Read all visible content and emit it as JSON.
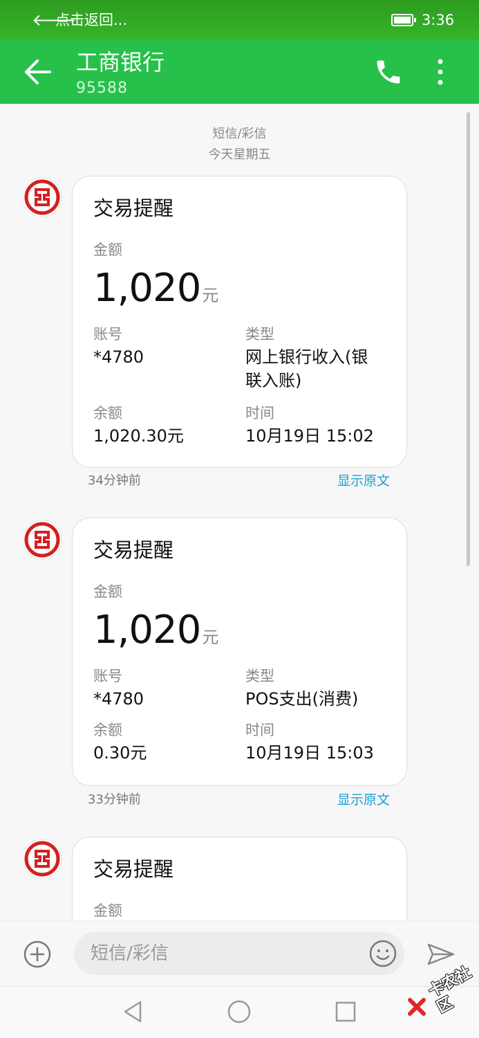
{
  "status_bar": {
    "back_label": "点击返回...",
    "time": "3:36"
  },
  "header": {
    "title": "工商银行",
    "number": "95588"
  },
  "thread": {
    "channel": "短信/彩信",
    "date": "今天星期五",
    "messages": [
      {
        "title": "交易提醒",
        "amount_label": "金额",
        "amount": "1,020",
        "unit": "元",
        "account_label": "账号",
        "account": "*4780",
        "type_label": "类型",
        "type_line1": "网上银行收入(银",
        "type_line2": "联入账)",
        "balance_label": "余额",
        "balance": "1,020.30元",
        "time_label": "时间",
        "time": "10月19日 15:02",
        "ago": "34分钟前",
        "show_original": "显示原文"
      },
      {
        "title": "交易提醒",
        "amount_label": "金额",
        "amount": "1,020",
        "unit": "元",
        "account_label": "账号",
        "account": "*4780",
        "type_label": "类型",
        "type": "POS支出(消费)",
        "balance_label": "余额",
        "balance": "0.30元",
        "time_label": "时间",
        "time": "10月19日 15:03",
        "ago": "33分钟前",
        "show_original": "显示原文"
      },
      {
        "title": "交易提醒",
        "amount_label": "金额"
      }
    ]
  },
  "composer": {
    "placeholder": "短信/彩信"
  },
  "watermark": {
    "text": "卡农社区"
  },
  "colors": {
    "header_green": "#27c04a",
    "link_blue": "#1a9fd3",
    "icbc_red": "#d42020"
  },
  "icons": {
    "status_back": "arrow-left-icon",
    "nav_back": "arrow-left-icon",
    "call": "phone-icon",
    "menu": "more-vertical-icon",
    "sender": "icbc-logo-icon",
    "attach": "plus-circle-icon",
    "emoji": "smiley-icon",
    "send": "send-icon",
    "system_back": "triangle-back-icon",
    "system_home": "circle-home-icon",
    "system_recents": "square-recents-icon"
  }
}
